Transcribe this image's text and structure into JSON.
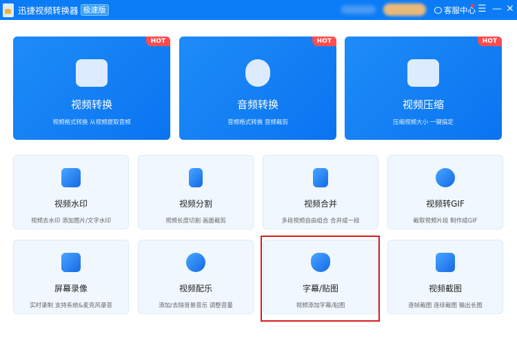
{
  "header": {
    "app_title": "迅捷视频转换器",
    "edition_badge": "极速版",
    "customer_service": "客服中心",
    "menu_icon": "☰",
    "minimize_icon": "—",
    "close_icon": "✕"
  },
  "hot_label": "HOT",
  "featured": [
    {
      "title": "视频转换",
      "subtitle": "视频格式转换 从视频提取音频"
    },
    {
      "title": "音频转换",
      "subtitle": "音频格式转换 音频截剪"
    },
    {
      "title": "视频压缩",
      "subtitle": "压缩视频大小 一键搞定"
    }
  ],
  "tools": [
    {
      "title": "视频水印",
      "subtitle": "视频去水印 添加图片/文字水印"
    },
    {
      "title": "视频分割",
      "subtitle": "视频长度切割 画面截剪"
    },
    {
      "title": "视频合并",
      "subtitle": "多段视频自由组合 合并成一段"
    },
    {
      "title": "视频转GIF",
      "subtitle": "截取视频片段 制作成GIF"
    },
    {
      "title": "屏幕录像",
      "subtitle": "实时录制 支持系统&麦克风录音"
    },
    {
      "title": "视频配乐",
      "subtitle": "添加/去除背景音乐 调整音量"
    },
    {
      "title": "字幕/贴图",
      "subtitle": "视频添加字幕/贴图"
    },
    {
      "title": "视频截图",
      "subtitle": "逐帧截图 连续截图 输出长图"
    }
  ]
}
